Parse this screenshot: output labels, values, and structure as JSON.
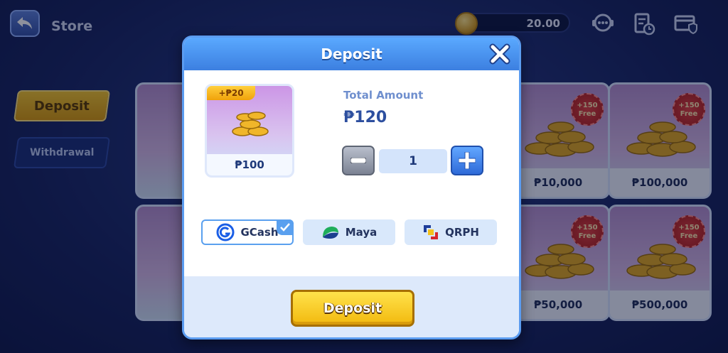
{
  "header": {
    "title": "Store",
    "balance": "20.00"
  },
  "sidebar": {
    "items": [
      {
        "label": "Deposit",
        "active": true
      },
      {
        "label": "Withdrawal",
        "active": false
      }
    ]
  },
  "store_cards": [
    {
      "price": "₱10,000",
      "badge": "+150 Free"
    },
    {
      "price": "₱100,000",
      "badge": "+150 Free"
    },
    {
      "price": "₱50,000",
      "badge": "+150 Free"
    },
    {
      "price": "₱500,000",
      "badge": "+150 Free"
    }
  ],
  "modal": {
    "title": "Deposit",
    "product": {
      "bonus": "+₱20",
      "price": "₱100"
    },
    "total_label": "Total Amount",
    "total_value": "₱120",
    "quantity": "1",
    "payment_methods": [
      {
        "label": "GCash",
        "selected": true,
        "icon": "gcash-logo-icon"
      },
      {
        "label": "Maya",
        "selected": false,
        "icon": "maya-logo-icon"
      },
      {
        "label": "QRPH",
        "selected": false,
        "icon": "qrph-logo-icon"
      }
    ],
    "deposit_button": "Deposit"
  },
  "colors": {
    "accent": "#3c7fe0",
    "button": "#f2b90e",
    "background": "#1b2a6b"
  }
}
